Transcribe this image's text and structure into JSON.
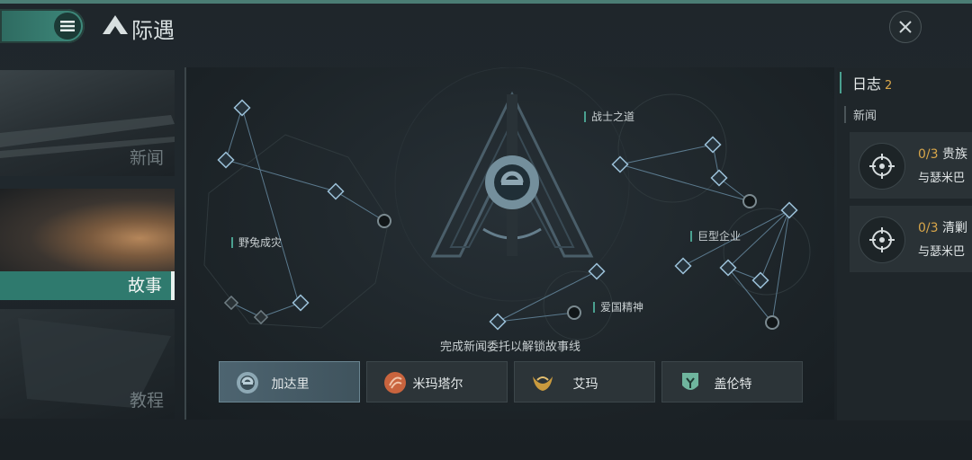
{
  "header": {
    "title": "际遇",
    "menu_icon": "hamburger-menu-icon",
    "close_icon": "close-icon"
  },
  "tabs": [
    {
      "label": "新闻",
      "active": false
    },
    {
      "label": "故事",
      "active": true
    },
    {
      "label": "教程",
      "active": false
    }
  ],
  "map": {
    "nodes": {
      "warrior": "战士之道",
      "wild": "野兔成灾",
      "corp": "巨型企业",
      "patriot": "爱国精神"
    },
    "hint": "完成新闻委托以解锁故事线"
  },
  "factions": [
    {
      "name": "加达里",
      "active": true,
      "icon": "caldari-emblem-icon"
    },
    {
      "name": "米玛塔尔",
      "active": false,
      "icon": "minmatar-emblem-icon"
    },
    {
      "name": "艾玛",
      "active": false,
      "icon": "amarr-emblem-icon"
    },
    {
      "name": "盖伦特",
      "active": false,
      "icon": "gallente-emblem-icon"
    }
  ],
  "log": {
    "title": "日志",
    "count": "2",
    "section": "新闻",
    "quests": [
      {
        "progress": "0/3",
        "name": "贵族",
        "target": "与瑟米巴"
      },
      {
        "progress": "0/3",
        "name": "清剿",
        "target": "与瑟米巴"
      }
    ]
  },
  "colors": {
    "accent": "#3e8a7c",
    "progress": "#d8a64a"
  }
}
